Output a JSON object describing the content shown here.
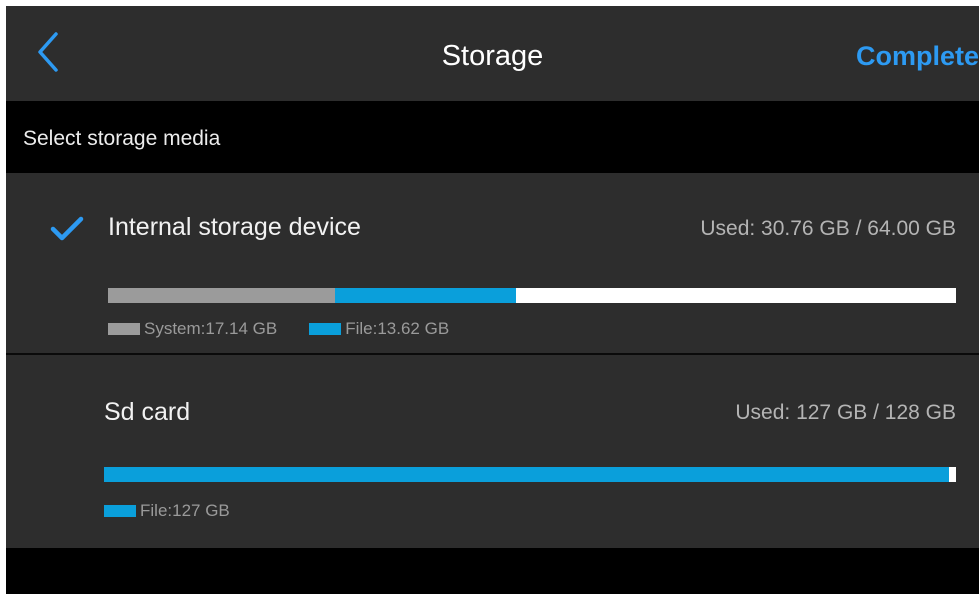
{
  "header": {
    "title": "Storage",
    "complete_label": "Complete"
  },
  "section_label": "Select storage media",
  "colors": {
    "accent": "#2d9af2",
    "system": "#9b9b9b",
    "file": "#0a9fdb",
    "free": "#ffffff"
  },
  "devices": [
    {
      "name": "Internal storage device",
      "selected": true,
      "used_text": "Used: 30.76 GB / 64.00 GB",
      "used_gb": 30.76,
      "total_gb": 64.0,
      "segments": [
        {
          "label": "System:17.14 GB",
          "gb": 17.14,
          "color": "#9b9b9b"
        },
        {
          "label": "File:13.62 GB",
          "gb": 13.62,
          "color": "#0a9fdb"
        }
      ]
    },
    {
      "name": "Sd card",
      "selected": false,
      "used_text": "Used: 127 GB / 128 GB",
      "used_gb": 127,
      "total_gb": 128,
      "segments": [
        {
          "label": "File:127 GB",
          "gb": 127,
          "color": "#0a9fdb"
        }
      ]
    }
  ]
}
